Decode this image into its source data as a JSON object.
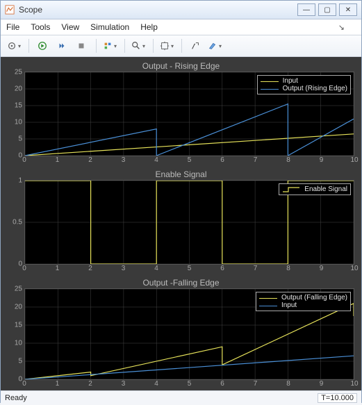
{
  "window": {
    "title": "Scope"
  },
  "menus": {
    "file": "File",
    "tools": "Tools",
    "view": "View",
    "simulation": "Simulation",
    "help": "Help"
  },
  "status": {
    "left": "Ready",
    "right": "T=10.000"
  },
  "colors": {
    "input": "#e6e25a",
    "rising": "#4a8fd6",
    "enable": "#e6e25a",
    "falling_out": "#e6e25a",
    "falling_in": "#4a8fd6",
    "grid": "#444"
  },
  "chart_data": [
    {
      "type": "line",
      "title": "Output - Rising Edge",
      "xlabel": "",
      "ylabel": "",
      "x": [
        0,
        1,
        2,
        3,
        4,
        5,
        6,
        7,
        8,
        9,
        10
      ],
      "ylim": [
        0,
        25
      ],
      "yticks": [
        0,
        5,
        10,
        15,
        20,
        25
      ],
      "legend_pos": "top-right",
      "series": [
        {
          "name": "Input",
          "color": "#e6e25a",
          "points": [
            [
              0,
              0
            ],
            [
              10,
              6.5
            ]
          ]
        },
        {
          "name": "Output (Rising Edge)",
          "color": "#4a8fd6",
          "points": [
            [
              0,
              0
            ],
            [
              4,
              8
            ],
            [
              4,
              0
            ],
            [
              8,
              15.5
            ],
            [
              8,
              0
            ],
            [
              10,
              11
            ]
          ]
        }
      ]
    },
    {
      "type": "line",
      "title": "Enable Signal",
      "xlabel": "",
      "ylabel": "",
      "x": [
        0,
        1,
        2,
        3,
        4,
        5,
        6,
        7,
        8,
        9,
        10
      ],
      "ylim": [
        0,
        1
      ],
      "yticks": [
        0,
        0.5,
        1
      ],
      "legend_pos": "top-right",
      "series": [
        {
          "name": "Enable Signal",
          "color": "#e6e25a",
          "step": true,
          "points": [
            [
              0,
              1
            ],
            [
              2,
              1
            ],
            [
              2,
              0
            ],
            [
              4,
              0
            ],
            [
              4,
              1
            ],
            [
              6,
              1
            ],
            [
              6,
              0
            ],
            [
              8,
              0
            ],
            [
              8,
              1
            ],
            [
              10,
              1
            ]
          ]
        }
      ]
    },
    {
      "type": "line",
      "title": "Output -Falling Edge",
      "xlabel": "",
      "ylabel": "",
      "x": [
        0,
        1,
        2,
        3,
        4,
        5,
        6,
        7,
        8,
        9,
        10
      ],
      "ylim": [
        0,
        25
      ],
      "yticks": [
        0,
        5,
        10,
        15,
        20,
        25
      ],
      "legend_pos": "top-right",
      "series": [
        {
          "name": "Output (Falling Edge)",
          "color": "#e6e25a",
          "points": [
            [
              0,
              0
            ],
            [
              2,
              2
            ],
            [
              2,
              1
            ],
            [
              6,
              9
            ],
            [
              6,
              4
            ],
            [
              10,
              21
            ],
            [
              10,
              17.5
            ]
          ]
        },
        {
          "name": "Input",
          "color": "#4a8fd6",
          "points": [
            [
              0,
              0
            ],
            [
              10,
              6.5
            ]
          ]
        }
      ]
    }
  ]
}
